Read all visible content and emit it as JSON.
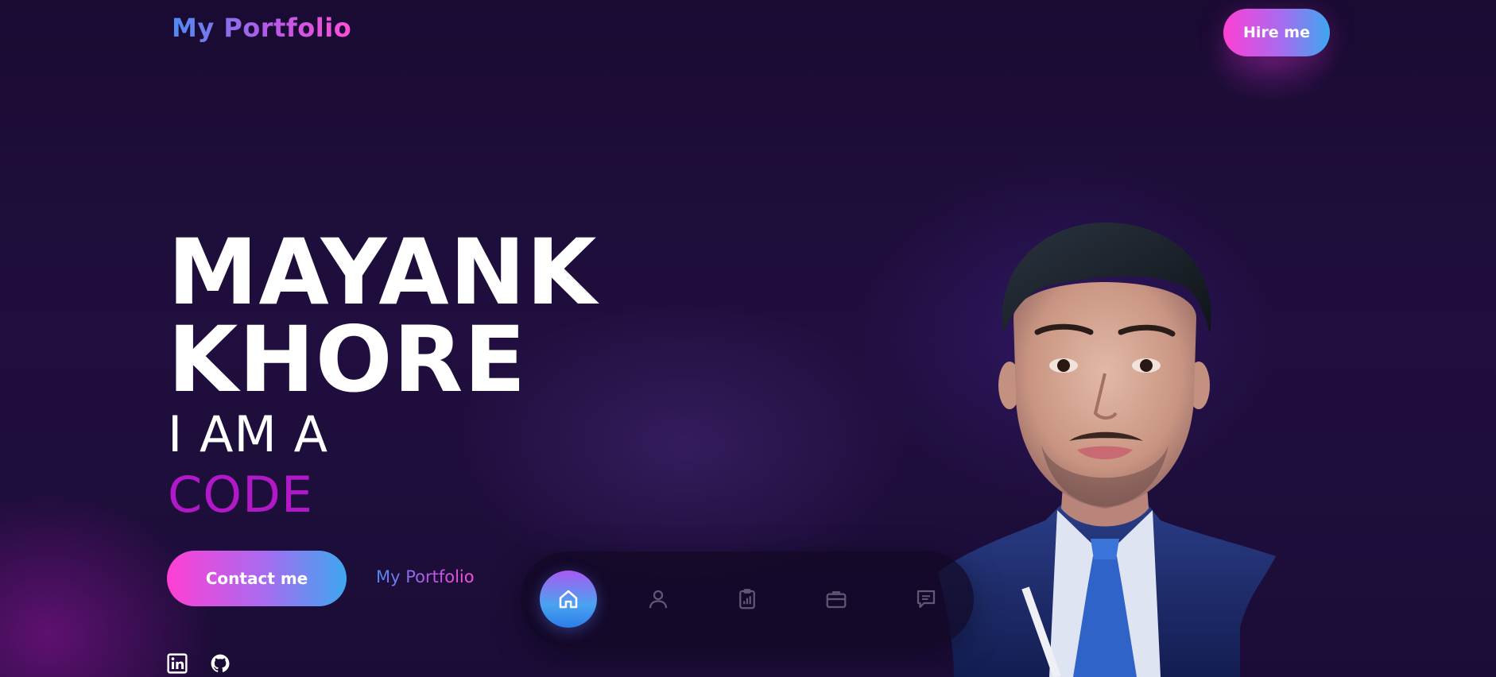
{
  "header": {
    "logo_text": "My Portfolio",
    "hire_label": "Hire me"
  },
  "hero": {
    "first_name": "MAYANK",
    "last_name": "KHORE",
    "intro": "I AM A",
    "role": "CODE",
    "contact_label": "Contact me",
    "portfolio_link": "My Portfolio"
  },
  "social": [
    {
      "icon": "linkedin-icon"
    },
    {
      "icon": "github-icon"
    }
  ],
  "dock": {
    "items": [
      {
        "icon": "home-icon",
        "active": true
      },
      {
        "icon": "user-icon",
        "active": false
      },
      {
        "icon": "clipboard-chart-icon",
        "active": false
      },
      {
        "icon": "briefcase-icon",
        "active": false
      },
      {
        "icon": "message-icon",
        "active": false
      }
    ]
  },
  "colors": {
    "background": "#1c0f38",
    "accent_pink": "#ff3fd4",
    "accent_blue": "#3da7f0",
    "role_purple": "#b018c8"
  }
}
